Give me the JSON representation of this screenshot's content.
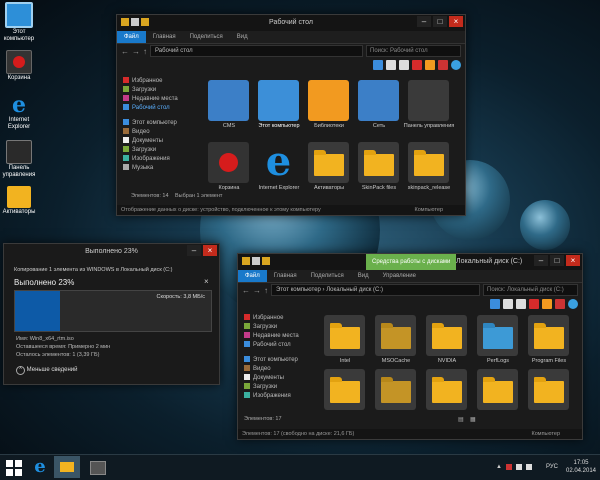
{
  "desktop": {
    "icons": [
      {
        "label": "Этот компьютер"
      },
      {
        "label": "Корзина"
      },
      {
        "label": "Internet Explorer"
      },
      {
        "label": "Панель управления"
      },
      {
        "label": "Активаторы"
      }
    ]
  },
  "top_window": {
    "title": "Рабочий стол",
    "ribbon_tabs": [
      "Файл",
      "Главная",
      "Поделиться",
      "Вид"
    ],
    "address": "Рабочий стол",
    "search_placeholder": "Поиск: Рабочий стол",
    "nav": {
      "favorites": "Избранное",
      "items": [
        "Загрузки",
        "Недавние места",
        "Рабочий стол"
      ],
      "computer": "Этот компьютер",
      "computer_items": [
        "Видео",
        "Документы",
        "Загрузки",
        "Изображения",
        "Музыка"
      ]
    },
    "tiles": [
      {
        "label": "CMS"
      },
      {
        "label": "Этот компьютер"
      },
      {
        "label": "Библиотеки"
      },
      {
        "label": "Сеть"
      },
      {
        "label": "Панель управления"
      },
      {
        "label": "Корзина"
      },
      {
        "label": "Internet Explorer"
      },
      {
        "label": "Активаторы"
      },
      {
        "label": "SkinPack files"
      },
      {
        "label": "skinpack_release"
      }
    ],
    "status_items": "Элементов: 14",
    "status_selected": "Выбран 1 элемент",
    "details": "Отображение данных о диске: устройство, подключенное к этому компьютеру",
    "details_right": "Компьютер"
  },
  "copy_dialog": {
    "title": "Выполнено 23%",
    "line1": "Копирование 1 элемента из WINDOWS в Локальный диск (C:)",
    "percent": "Выполнено 23%",
    "speed": "Скорость: 3,8 МБ/с",
    "progress": 0.23,
    "name": "Имя: Win8_x64_rtm.iso",
    "remaining_time": "Оставшееся время: Примерно 2 мин",
    "remaining_items": "Осталось элементов: 1 (3,39 ГБ)",
    "less_details": "Меньше сведений"
  },
  "bottom_window": {
    "title": "Локальный диск (C:)",
    "context_tab": "Средства работы с дисками",
    "ribbon_tabs": [
      "Файл",
      "Главная",
      "Поделиться",
      "Вид",
      "Управление"
    ],
    "address": "Этот компьютер  ›  Локальный диск (C:)",
    "search_placeholder": "Поиск: Локальный диск (C:)",
    "nav": {
      "favorites": "Избранное",
      "items": [
        "Загрузки",
        "Недавние места",
        "Рабочий стол"
      ],
      "computer": "Этот компьютер",
      "computer_items": [
        "Видео",
        "Документы",
        "Загрузки",
        "Изображения"
      ]
    },
    "folders": [
      {
        "label": "Intel"
      },
      {
        "label": "MSOCache"
      },
      {
        "label": "NVIDIA"
      },
      {
        "label": "PerfLogs"
      },
      {
        "label": "Program Files"
      },
      {
        "label": ""
      },
      {
        "label": ""
      },
      {
        "label": ""
      },
      {
        "label": ""
      },
      {
        "label": ""
      }
    ],
    "status_items": "Элементов: 17",
    "details": "Элементов: 17 (свободно на диске: 21,6 ГБ)",
    "details_right": "Компьютер"
  },
  "taskbar": {
    "lang": "РУС",
    "time": "17:05",
    "date": "02.04.2014"
  },
  "colors": {
    "accent": "#1979ca",
    "folder": "#f2b320",
    "close": "#c42b1c",
    "progress": "#0d5aa7"
  }
}
